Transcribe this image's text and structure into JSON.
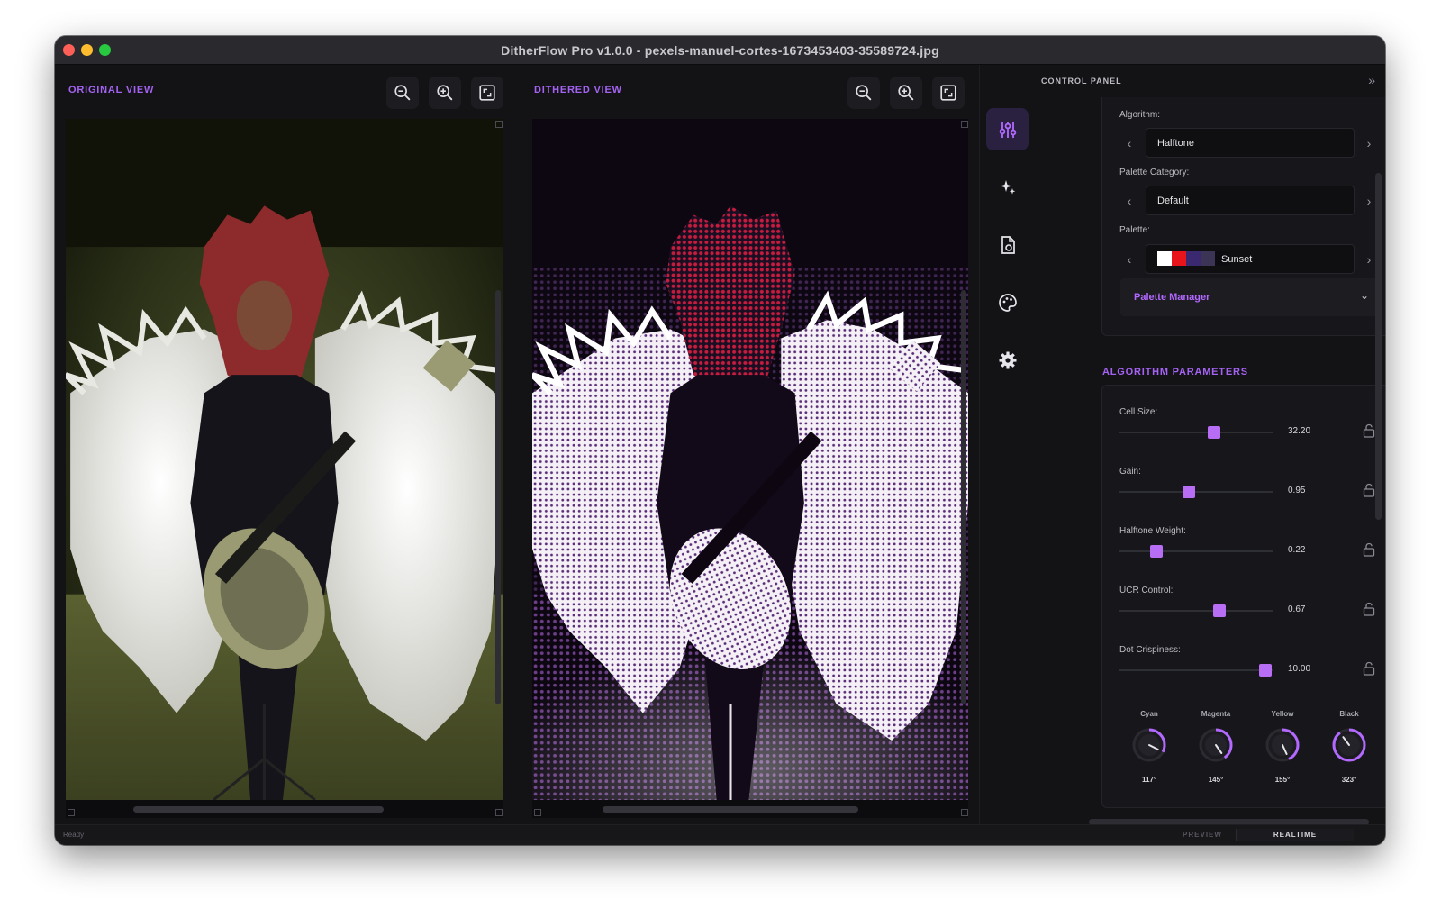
{
  "window": {
    "title": "DitherFlow Pro v1.0.0 - pexels-manuel-cortes-1673453403-35589724.jpg"
  },
  "views": {
    "original": {
      "title": "ORIGINAL VIEW",
      "zoom_out_icon": "zoom-out-icon",
      "zoom_in_icon": "zoom-in-icon",
      "fit_icon": "fit-screen-icon"
    },
    "dithered": {
      "title": "DITHERED VIEW",
      "zoom_out_icon": "zoom-out-icon",
      "zoom_in_icon": "zoom-in-icon",
      "fit_icon": "fit-screen-icon"
    }
  },
  "sidebar": {
    "items": [
      {
        "icon": "sliders-icon",
        "active": true
      },
      {
        "icon": "sparkles-icon",
        "active": false
      },
      {
        "icon": "document-icon",
        "active": false
      },
      {
        "icon": "palette-icon",
        "active": false
      },
      {
        "icon": "gear-icon",
        "active": false
      }
    ]
  },
  "control_panel": {
    "title": "CONTROL PANEL",
    "algorithm": {
      "label": "Algorithm:",
      "value": "Halftone"
    },
    "palette_category": {
      "label": "Palette Category:",
      "value": "Default"
    },
    "palette": {
      "label": "Palette:",
      "value": "Sunset",
      "colors": [
        "#ffffff",
        "#e8141c",
        "#3a2870",
        "#3b3454",
        "#0c0c10"
      ]
    },
    "palette_manager": {
      "label": "Palette Manager"
    },
    "algorithm_parameters": {
      "title": "ALGORITHM PARAMETERS",
      "params": [
        {
          "label": "Cell Size:",
          "value": "32.20",
          "fraction": 0.62
        },
        {
          "label": "Gain:",
          "value": "0.95",
          "fraction": 0.45
        },
        {
          "label": "Halftone Weight:",
          "value": "0.22",
          "fraction": 0.24
        },
        {
          "label": "UCR Control:",
          "value": "0.67",
          "fraction": 0.65
        },
        {
          "label": "Dot Crispiness:",
          "value": "10.00",
          "fraction": 0.95
        }
      ],
      "channels": [
        {
          "label": "Cyan",
          "value": "117°",
          "angle": 117
        },
        {
          "label": "Magenta",
          "value": "145°",
          "angle": 145
        },
        {
          "label": "Yellow",
          "value": "155°",
          "angle": 155
        },
        {
          "label": "Black",
          "value": "323°",
          "angle": 323
        }
      ]
    }
  },
  "statusbar": {
    "status": "Ready",
    "preview_label": "PREVIEW",
    "realtime_label": "REALTIME"
  },
  "colors": {
    "accent": "#a463f2",
    "thumb": "#b86df5",
    "background": "#131316"
  }
}
